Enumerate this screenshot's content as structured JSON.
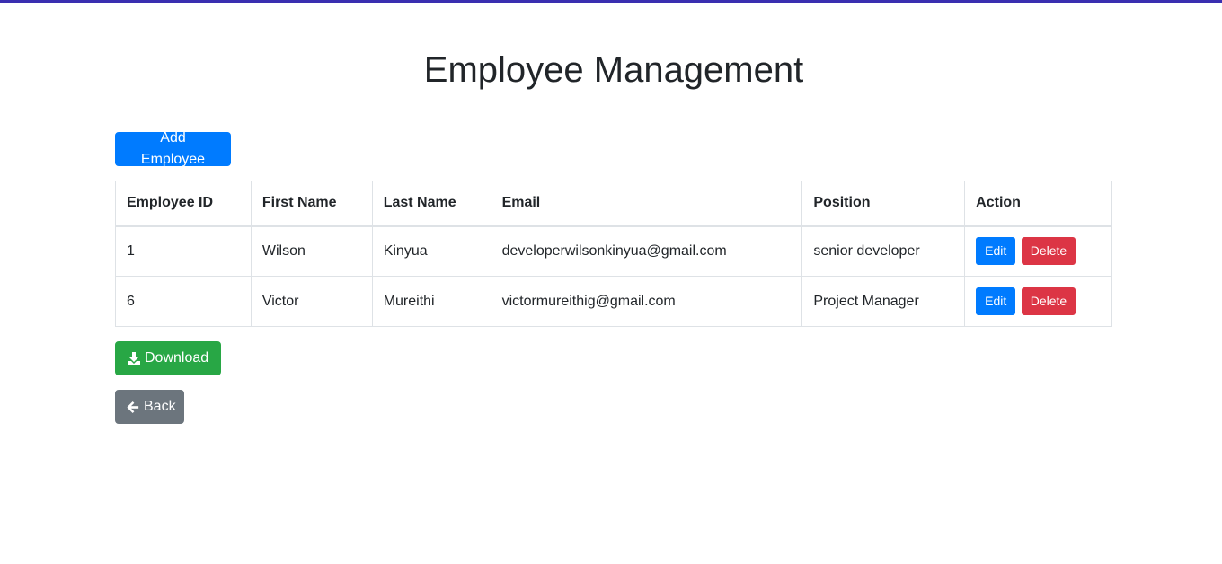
{
  "page": {
    "title": "Employee Management"
  },
  "toolbar": {
    "add_label": "Add Employee"
  },
  "table": {
    "headers": [
      "Employee ID",
      "First Name",
      "Last Name",
      "Email",
      "Position",
      "Action"
    ],
    "rows": [
      {
        "id": "1",
        "first_name": "Wilson",
        "last_name": "Kinyua",
        "email": "developerwilsonkinyua@gmail.com",
        "position": "senior developer"
      },
      {
        "id": "6",
        "first_name": "Victor",
        "last_name": "Mureithi",
        "email": "victormureithig@gmail.com",
        "position": "Project Manager"
      }
    ],
    "edit_label": "Edit",
    "delete_label": "Delete"
  },
  "footer": {
    "download_label": "Download",
    "download_icon": "download-icon",
    "back_label": "Back",
    "back_icon": "arrow-left-icon"
  },
  "colors": {
    "primary": "#007bff",
    "success": "#28a745",
    "danger": "#dc3545",
    "secondary": "#6c757d",
    "top_bar": "#3a2fb0"
  }
}
